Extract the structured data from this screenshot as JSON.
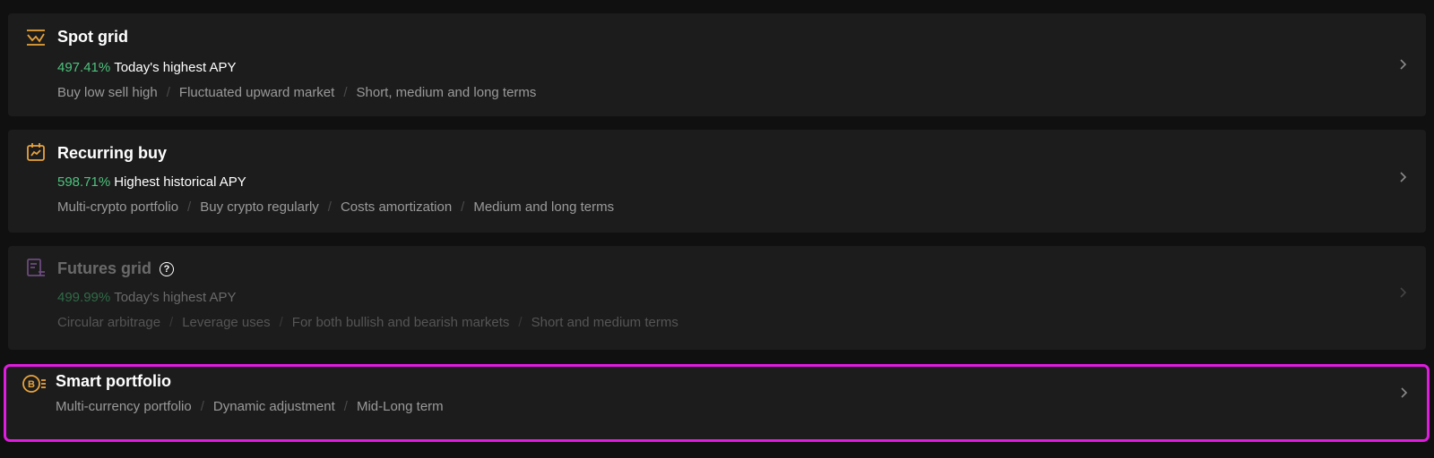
{
  "colors": {
    "background": "#101010",
    "card": "#1c1c1c",
    "accent_orange": "#e8a33b",
    "apy_green": "#4ec27d",
    "highlight_magenta": "#e11be0",
    "disabled_purple": "#6b4a7d"
  },
  "strategies": [
    {
      "title": "Spot grid",
      "icon": "grid-chart-icon",
      "apy_value": "497.41%",
      "apy_label": "Today's highest APY",
      "tags": [
        "Buy low sell high",
        "Fluctuated upward market",
        "Short, medium and long terms"
      ]
    },
    {
      "title": "Recurring buy",
      "icon": "calendar-chart-icon",
      "apy_value": "598.71%",
      "apy_label": "Highest historical APY",
      "tags": [
        "Multi-crypto portfolio",
        "Buy crypto regularly",
        "Costs amortization",
        "Medium and long terms"
      ]
    },
    {
      "title": "Futures grid",
      "icon": "futures-document-icon",
      "help": "?",
      "disabled": true,
      "apy_value": "499.99%",
      "apy_label": "Today's highest APY",
      "tags": [
        "Circular arbitrage",
        "Leverage uses",
        "For both bullish and bearish markets",
        "Short and medium terms"
      ]
    },
    {
      "title": "Smart portfolio",
      "icon": "bitcoin-portfolio-icon",
      "coin_symbol": "B",
      "selected": true,
      "tags": [
        "Multi-currency portfolio",
        "Dynamic adjustment",
        "Mid-Long term"
      ]
    }
  ],
  "separator": "/"
}
